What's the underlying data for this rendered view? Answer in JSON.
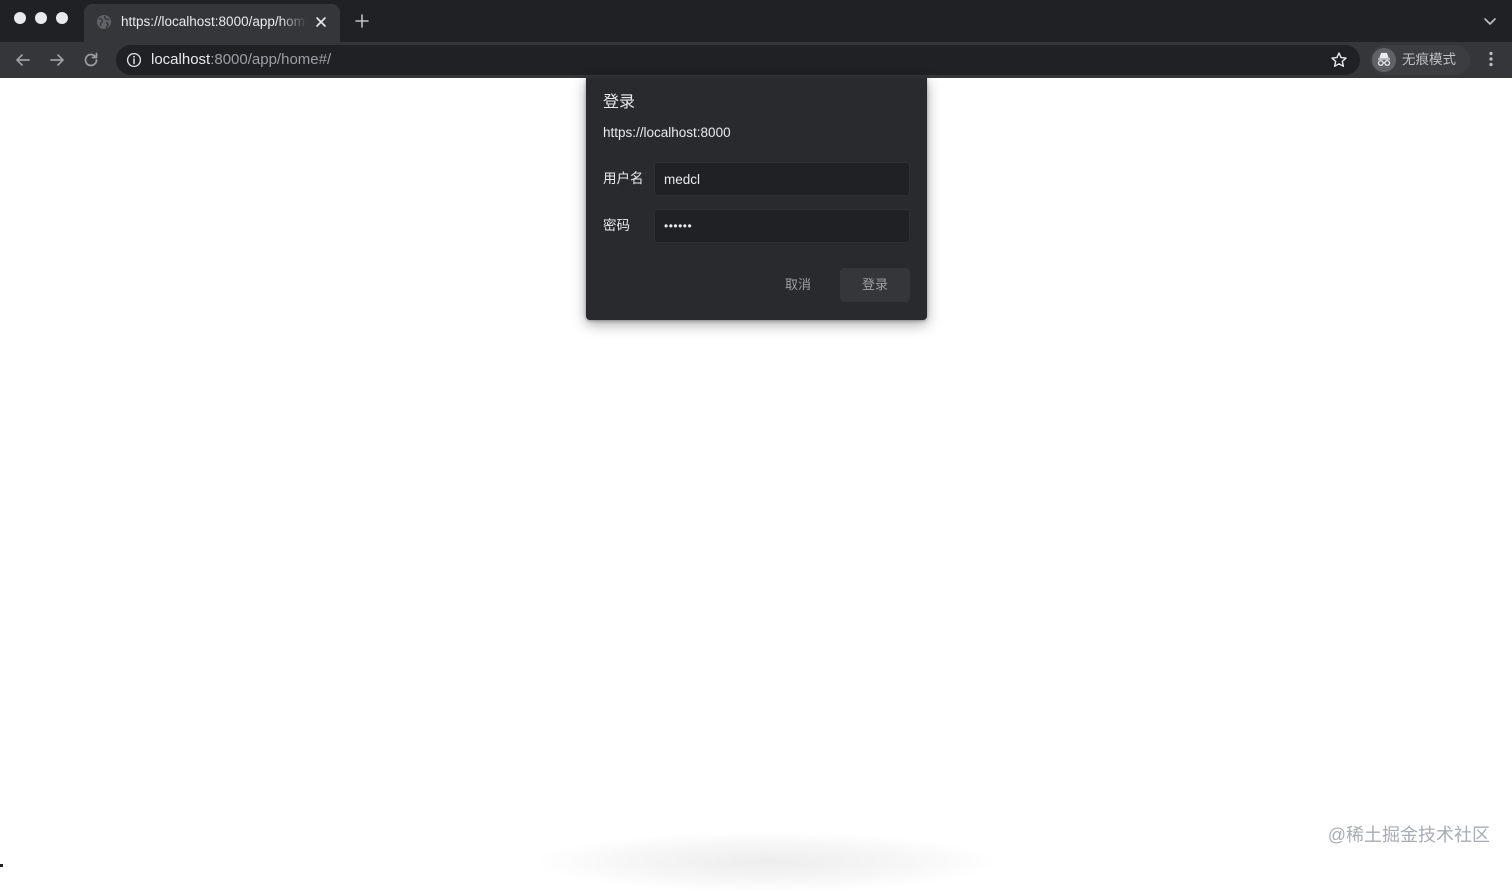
{
  "browser": {
    "tab": {
      "title": "https://localhost:8000/app/home#/"
    },
    "address_bar": {
      "host": "localhost",
      "path": ":8000/app/home#/"
    },
    "incognito_label": "无痕模式",
    "icons": {
      "window_controls": [
        "close-dot",
        "minimize-dot",
        "zoom-dot"
      ],
      "tab_favicon": "globe-icon",
      "tab_close": "close-icon",
      "new_tab": "plus-icon",
      "tab_search": "chevron-down-icon",
      "back": "arrow-left-icon",
      "forward": "arrow-right-icon",
      "reload": "reload-icon",
      "site_info": "info-icon",
      "bookmark": "star-icon",
      "incognito": "incognito-icon",
      "menu": "kebab-menu-icon"
    },
    "colors": {
      "tabstrip": "#202124",
      "toolbar": "#35363a",
      "omnibox": "#202124",
      "text": "#e8eaed",
      "muted": "#9aa0a6"
    }
  },
  "login_dialog": {
    "title": "登录",
    "origin": "https://localhost:8000",
    "username": {
      "label": "用户名",
      "value": "medcl"
    },
    "password": {
      "label": "密码",
      "value": "••••••"
    },
    "cancel_label": "取消",
    "submit_label": "登录",
    "colors": {
      "background": "#292a2d",
      "input_background": "#202124",
      "button_background": "#35363a"
    }
  },
  "page": {
    "background": "#ffffff",
    "watermark": "@稀土掘金技术社区"
  }
}
